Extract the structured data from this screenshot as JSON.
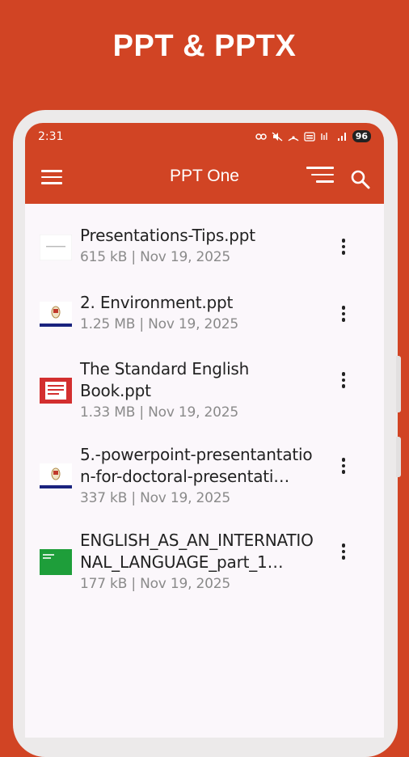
{
  "hero": {
    "title": "PPT & PPTX"
  },
  "statusbar": {
    "time": "2:31",
    "battery": "96"
  },
  "appbar": {
    "title": "PPT One",
    "menu_icon": "hamburger-menu-icon",
    "sort_icon": "sort-icon",
    "search_icon": "search-icon"
  },
  "files": [
    {
      "name": "Presentations-Tips.ppt",
      "meta": "615 kB | Nov 19, 2025",
      "thumb": "white-slide"
    },
    {
      "name": "2. Environment.ppt",
      "meta": "1.25 MB | Nov 19, 2025",
      "thumb": "crest-slide"
    },
    {
      "name": "The Standard English Book.ppt",
      "meta": "1.33 MB | Nov 19, 2025",
      "thumb": "red-slide"
    },
    {
      "name": "5.-powerpoint-presentantation-for-doctoral-presentati…",
      "meta": "337 kB | Nov 19, 2025",
      "thumb": "crest-slide"
    },
    {
      "name": "ENGLISH_AS_AN_INTERNATIONAL_LANGUAGE_part_1…",
      "meta": "177 kB | Nov 19, 2025",
      "thumb": "green-slide"
    }
  ],
  "colors": {
    "brand": "#d14424",
    "background": "#fbf7fb",
    "meta_text": "#8a8a8a"
  }
}
